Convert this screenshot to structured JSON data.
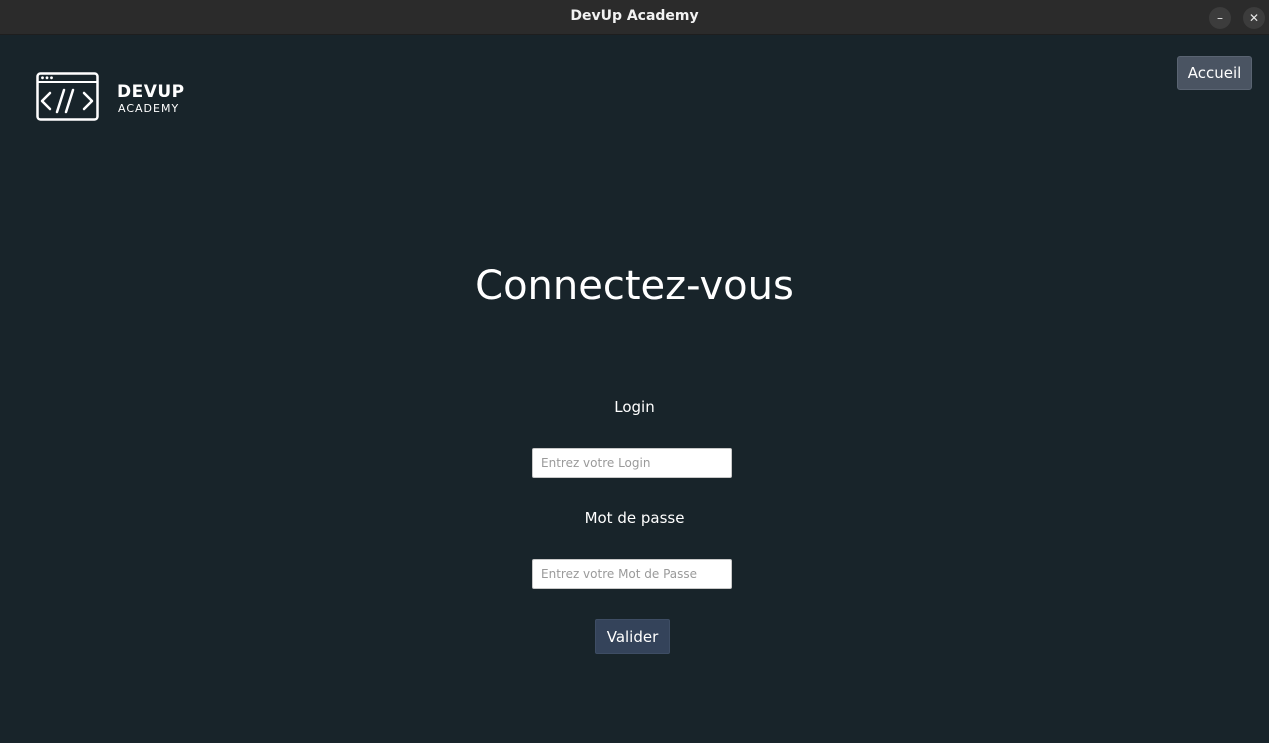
{
  "window": {
    "title": "DevUp Academy",
    "minimize_label": "–",
    "close_label": "✕"
  },
  "logo": {
    "name": "DEVUP",
    "subtitle": "ACADEMY",
    "icon": "code-window-icon"
  },
  "header": {
    "accueil_label": "Accueil"
  },
  "form": {
    "title": "Connectez-vous",
    "login_label": "Login",
    "login_placeholder": "Entrez votre Login",
    "login_value": "",
    "password_label": "Mot de passe",
    "password_placeholder": "Entrez votre Mot de Passe",
    "password_value": "",
    "submit_label": "Valider"
  },
  "colors": {
    "background": "#18242a",
    "titlebar": "#2b2b2b",
    "accueil_button": "#4a5462",
    "submit_button": "#34435a",
    "text": "#ffffff"
  }
}
